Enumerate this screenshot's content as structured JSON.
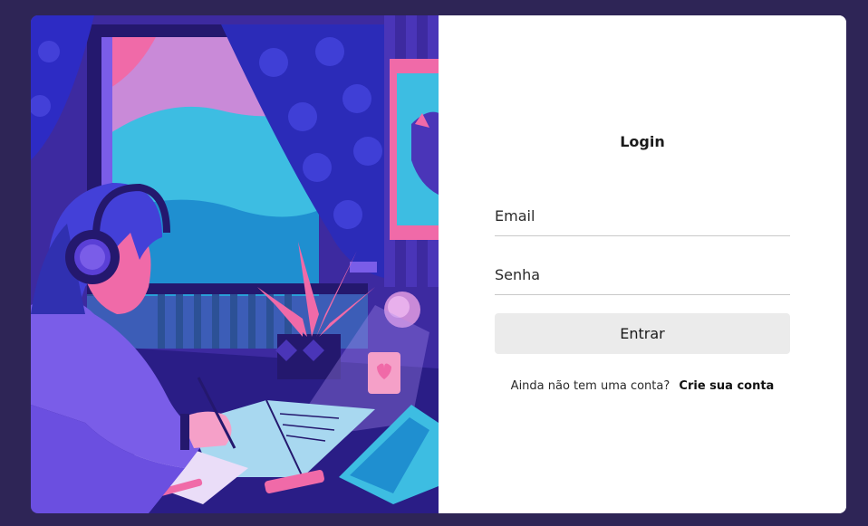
{
  "login": {
    "title": "Login",
    "email_placeholder": "Email",
    "password_placeholder": "Senha",
    "submit_label": "Entrar",
    "signup_prompt": "Ainda não tem uma conta?",
    "signup_link": "Crie sua conta"
  },
  "colors": {
    "background": "#2e2556",
    "card": "#ffffff",
    "button": "#ebebeb",
    "accent_purple": "#5a3fd6",
    "accent_pink": "#f06aa8",
    "accent_cyan": "#3dbde2"
  },
  "illustration": {
    "subject": "girl-with-headphones-studying-at-desk-by-window"
  }
}
